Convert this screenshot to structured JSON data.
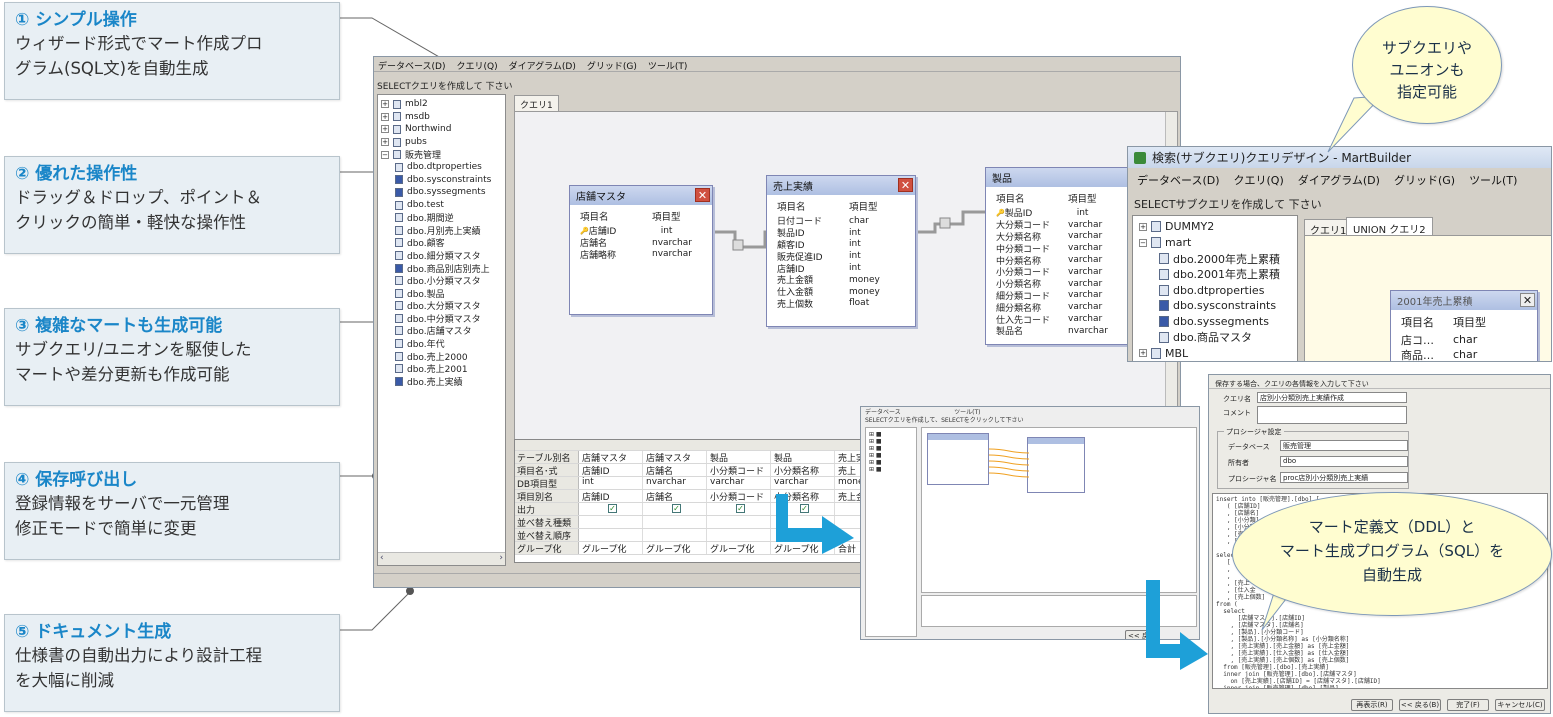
{
  "callouts": [
    {
      "title": "① シンプル操作",
      "lines": [
        "ウィザード形式でマート作成プロ",
        "グラム(SQL文)を自動生成"
      ]
    },
    {
      "title": "② 優れた操作性",
      "lines": [
        "ドラッグ＆ドロップ、ポイント＆",
        "クリックの簡単・軽快な操作性"
      ]
    },
    {
      "title": "③ 複雑なマートも生成可能",
      "lines": [
        "サブクエリ/ユニオンを駆使した",
        "マートや差分更新も作成可能"
      ]
    },
    {
      "title": "④ 保存呼び出し",
      "lines": [
        "登録情報をサーバで一元管理",
        "修正モードで簡単に変更"
      ]
    },
    {
      "title": "⑤ ドキュメント生成",
      "lines": [
        "仕様書の自動出力により設計工程",
        "を大幅に削減"
      ]
    }
  ],
  "main_window": {
    "menu": [
      "データベース(D)",
      "クエリ(Q)",
      "ダイアグラム(D)",
      "グリッド(G)",
      "ツール(T)"
    ],
    "instruction": "SELECTクエリを作成して 下さい",
    "tree": [
      "mbl2",
      "msdb",
      "Northwind",
      "pubs",
      "販売管理",
      "dbo.dtproperties",
      "dbo.sysconstraints",
      "dbo.syssegments",
      "dbo.test",
      "dbo.期間逆",
      "dbo.月別売上実績",
      "dbo.顧客",
      "dbo.細分類マスタ",
      "dbo.商品別店別売上",
      "dbo.小分類マスタ",
      "dbo.製品",
      "dbo.大分類マスタ",
      "dbo.中分類マスタ",
      "dbo.店舗マスタ",
      "dbo.年代",
      "dbo.売上2000",
      "dbo.売上2001",
      "dbo.売上実績"
    ],
    "tab": "クエリ1",
    "tables": [
      {
        "title": "店舗マスタ",
        "col_hdr": [
          "項目名",
          "項目型"
        ],
        "rows": [
          [
            "店舗ID",
            "int"
          ],
          [
            "店舗名",
            "nvarchar"
          ],
          [
            "店舗略称",
            "nvarchar"
          ]
        ]
      },
      {
        "title": "売上実績",
        "col_hdr": [
          "項目名",
          "項目型"
        ],
        "rows": [
          [
            "日付コード",
            "char"
          ],
          [
            "製品ID",
            "int"
          ],
          [
            "顧客ID",
            "int"
          ],
          [
            "販売促進ID",
            "int"
          ],
          [
            "店舗ID",
            "int"
          ],
          [
            "売上金額",
            "money"
          ],
          [
            "仕入金額",
            "money"
          ],
          [
            "売上個数",
            "float"
          ]
        ]
      },
      {
        "title": "製品",
        "col_hdr": [
          "項目名",
          "項目型"
        ],
        "rows": [
          [
            "製品ID",
            "int"
          ],
          [
            "大分類コード",
            "varchar"
          ],
          [
            "大分類名称",
            "varchar"
          ],
          [
            "中分類コード",
            "varchar"
          ],
          [
            "中分類名称",
            "varchar"
          ],
          [
            "小分類コード",
            "varchar"
          ],
          [
            "小分類名称",
            "varchar"
          ],
          [
            "細分類コード",
            "varchar"
          ],
          [
            "細分類名称",
            "varchar"
          ],
          [
            "仕入先コード",
            "varchar"
          ],
          [
            "製品名",
            "nvarchar"
          ]
        ]
      }
    ],
    "grid": {
      "row_headers": [
        "テーブル別名",
        "項目名･式",
        "DB項目型",
        "項目別名",
        "出力",
        "並べ替え種類",
        "並べ替え順序",
        "グループ化"
      ],
      "columns": [
        [
          "店舗マスタ",
          "店舗ID",
          "int",
          "店舗ID",
          "✓",
          "",
          "",
          "グループ化"
        ],
        [
          "店舗マスタ",
          "店舗名",
          "nvarchar",
          "店舗名",
          "✓",
          "",
          "",
          "グループ化"
        ],
        [
          "製品",
          "小分類コード",
          "varchar",
          "小分類コード",
          "✓",
          "",
          "",
          "グループ化"
        ],
        [
          "製品",
          "小分類名称",
          "varchar",
          "小分類名称",
          "✓",
          "",
          "",
          "グループ化"
        ],
        [
          "売上実",
          "売上",
          "money",
          "売上金",
          "",
          "",
          "",
          "合計"
        ]
      ]
    }
  },
  "subquery_window": {
    "title": "検索(サブクエリ)クエリデザイン - MartBuilder",
    "menu": [
      "データベース(D)",
      "クエリ(Q)",
      "ダイアグラム(D)",
      "グリッド(G)",
      "ツール(T)"
    ],
    "instruction": "SELECTサブクエリを作成して 下さい",
    "tree": [
      "DUMMY2",
      "mart",
      "dbo.2000年売上累積",
      "dbo.2001年売上累積",
      "dbo.dtproperties",
      "dbo.sysconstraints",
      "dbo.syssegments",
      "dbo.商品マスタ",
      "MBL"
    ],
    "tabs": [
      "クエリ1",
      "UNION クエリ2"
    ],
    "table": {
      "title": "2001年売上累積",
      "col_hdr": [
        "項目名",
        "項目型"
      ],
      "rows": [
        [
          "店コ…",
          "char"
        ],
        [
          "商品…",
          "char"
        ]
      ]
    }
  },
  "bubble_top": [
    "サブクエリや",
    "ユニオンも",
    "指定可能"
  ],
  "bubble_bottom": [
    "マート定義文（DDL）と",
    "マート生成プログラム（SQL）を",
    "自動生成"
  ],
  "save_dialog": {
    "prompt": "保存する場合、クエリの各情報を入力して下さい",
    "query_name_label": "クエリ名",
    "query_name": "店別小分類別売上実績作成",
    "comment_label": "コメント",
    "proc_group": "プロシージャ設定",
    "db_label": "データベース",
    "db_value": "販売管理",
    "owner_label": "所有者",
    "owner_value": "dbo",
    "proc_label": "プロシージャ名",
    "proc_value": "proc店別小分類別売上実績",
    "sql": "insert into [販売管理].[dbo].[\n   ( [店舗ID]\n   , [店舗名]\n   , [小分類]\n   , [小分類]\n   , [売上\n   , [\n\nselect\n   [\n   ,\n   ,\n   , [売上\n   , [仕入金\n   , [売上個数]\nfrom (\n  select\n      [店舗マスタ].[店舗ID]\n    , [店舗マスタ].[店舗名]\n    , [製品].[小分類コード]\n    , [製品].[小分類名称] as [小分類名称]\n    , [売上実績].[売上金額] as [売上金額]\n    , [売上実績].[仕入金額] as [仕入金額]\n    , [売上実績].[売上個数] as [売上個数]\n  from [販売管理].[dbo].[売上実績]\n  inner join [販売管理].[dbo].[店舗マスタ]\n    on [売上実績].[店舗ID] = [店舗マスタ].[店舗ID]\n  inner join [販売管理].[dbo].[製品]\n    on [売上実績].[製品ID] = [製品].[製品ID]",
    "buttons": [
      "再表示(R)",
      "<< 戻る(B)",
      "完了(F)",
      "キャンセル(C)"
    ]
  },
  "mini_window": {
    "menu": [
      "データベース",
      "ツール(T)"
    ],
    "instruction": "SELECTクエリを作成して、SELECTをクリックして下さい",
    "button": "<< 戻る"
  },
  "colors": {
    "accent": "#1a86c8",
    "arrow": "#1ea0d8",
    "bubble": "#fffdd0"
  }
}
